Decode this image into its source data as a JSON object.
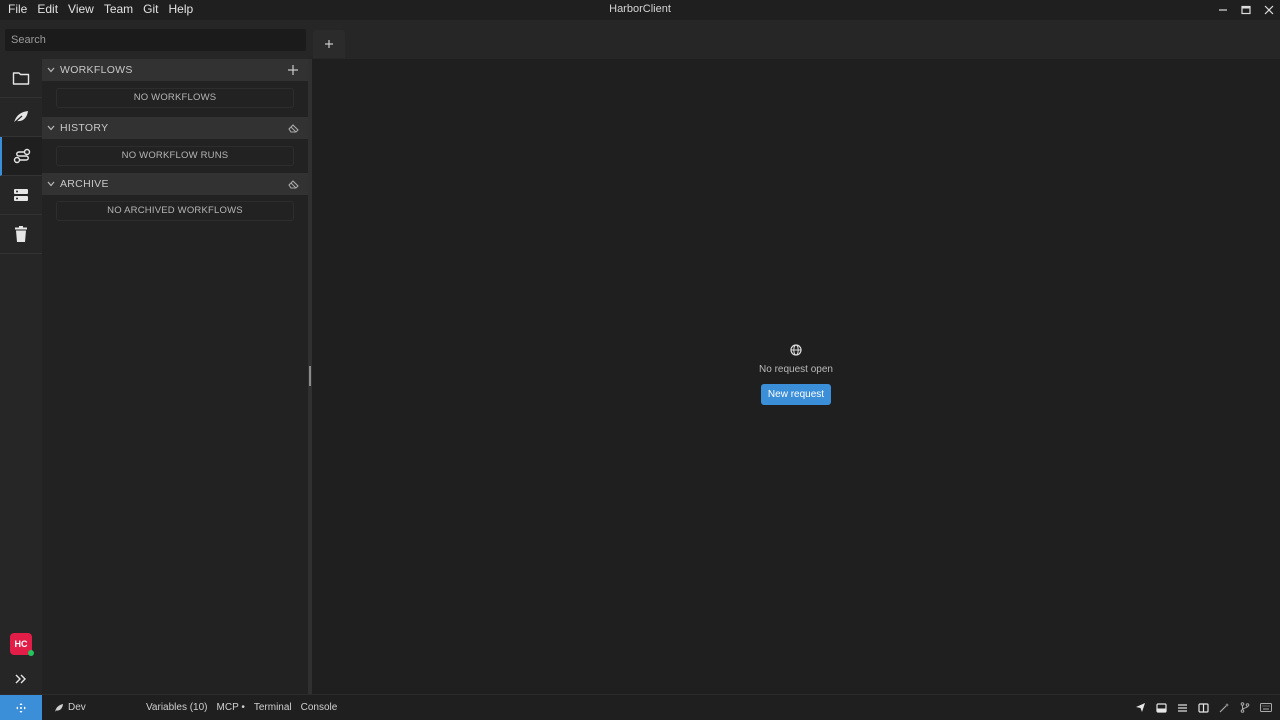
{
  "app": {
    "title": "HarborClient"
  },
  "menu": [
    "File",
    "Edit",
    "View",
    "Team",
    "Git",
    "Help"
  ],
  "search": {
    "placeholder": "Search"
  },
  "sections": {
    "workflows": {
      "title": "WORKFLOWS",
      "empty": "NO WORKFLOWS"
    },
    "history": {
      "title": "HISTORY",
      "empty": "NO WORKFLOW RUNS"
    },
    "archive": {
      "title": "ARCHIVE",
      "empty": "NO ARCHIVED WORKFLOWS"
    }
  },
  "user": {
    "initials": "HC",
    "status_color": "#22c55e"
  },
  "main": {
    "empty_text": "No request open",
    "new_request_label": "New request"
  },
  "status": {
    "environment": "Dev",
    "variables": "Variables (10)",
    "mcp": "MCP •",
    "terminal": "Terminal",
    "console": "Console"
  },
  "colors": {
    "accent": "#3b8ed8",
    "avatar": "#e11d48"
  }
}
